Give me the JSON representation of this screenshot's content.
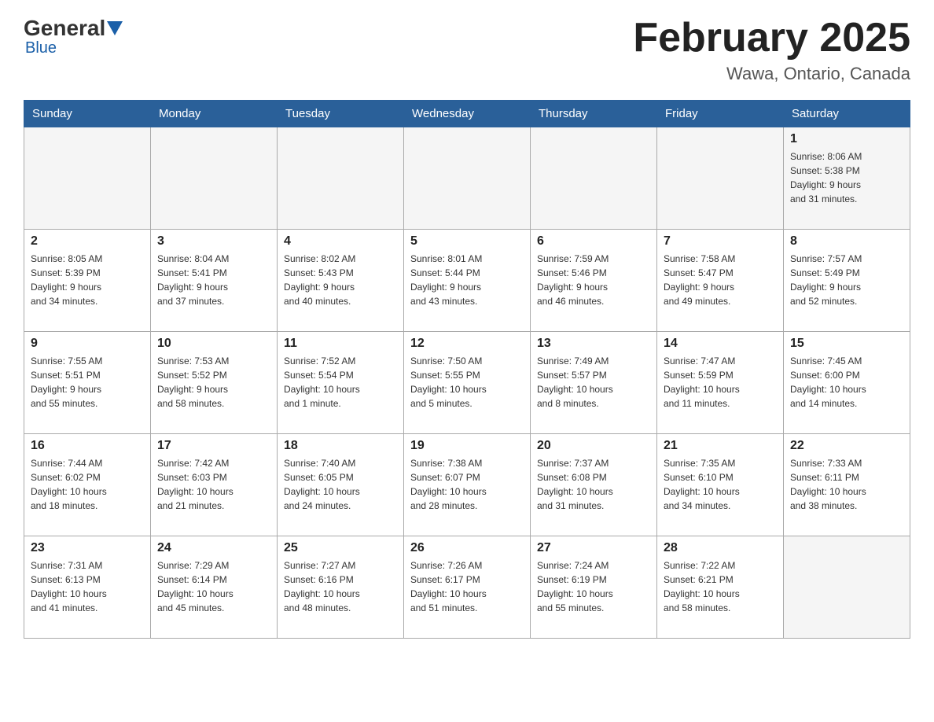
{
  "header": {
    "logo_general": "General",
    "logo_blue": "Blue",
    "month_title": "February 2025",
    "location": "Wawa, Ontario, Canada"
  },
  "weekdays": [
    "Sunday",
    "Monday",
    "Tuesday",
    "Wednesday",
    "Thursday",
    "Friday",
    "Saturday"
  ],
  "weeks": [
    [
      {
        "day": "",
        "info": ""
      },
      {
        "day": "",
        "info": ""
      },
      {
        "day": "",
        "info": ""
      },
      {
        "day": "",
        "info": ""
      },
      {
        "day": "",
        "info": ""
      },
      {
        "day": "",
        "info": ""
      },
      {
        "day": "1",
        "info": "Sunrise: 8:06 AM\nSunset: 5:38 PM\nDaylight: 9 hours\nand 31 minutes."
      }
    ],
    [
      {
        "day": "2",
        "info": "Sunrise: 8:05 AM\nSunset: 5:39 PM\nDaylight: 9 hours\nand 34 minutes."
      },
      {
        "day": "3",
        "info": "Sunrise: 8:04 AM\nSunset: 5:41 PM\nDaylight: 9 hours\nand 37 minutes."
      },
      {
        "day": "4",
        "info": "Sunrise: 8:02 AM\nSunset: 5:43 PM\nDaylight: 9 hours\nand 40 minutes."
      },
      {
        "day": "5",
        "info": "Sunrise: 8:01 AM\nSunset: 5:44 PM\nDaylight: 9 hours\nand 43 minutes."
      },
      {
        "day": "6",
        "info": "Sunrise: 7:59 AM\nSunset: 5:46 PM\nDaylight: 9 hours\nand 46 minutes."
      },
      {
        "day": "7",
        "info": "Sunrise: 7:58 AM\nSunset: 5:47 PM\nDaylight: 9 hours\nand 49 minutes."
      },
      {
        "day": "8",
        "info": "Sunrise: 7:57 AM\nSunset: 5:49 PM\nDaylight: 9 hours\nand 52 minutes."
      }
    ],
    [
      {
        "day": "9",
        "info": "Sunrise: 7:55 AM\nSunset: 5:51 PM\nDaylight: 9 hours\nand 55 minutes."
      },
      {
        "day": "10",
        "info": "Sunrise: 7:53 AM\nSunset: 5:52 PM\nDaylight: 9 hours\nand 58 minutes."
      },
      {
        "day": "11",
        "info": "Sunrise: 7:52 AM\nSunset: 5:54 PM\nDaylight: 10 hours\nand 1 minute."
      },
      {
        "day": "12",
        "info": "Sunrise: 7:50 AM\nSunset: 5:55 PM\nDaylight: 10 hours\nand 5 minutes."
      },
      {
        "day": "13",
        "info": "Sunrise: 7:49 AM\nSunset: 5:57 PM\nDaylight: 10 hours\nand 8 minutes."
      },
      {
        "day": "14",
        "info": "Sunrise: 7:47 AM\nSunset: 5:59 PM\nDaylight: 10 hours\nand 11 minutes."
      },
      {
        "day": "15",
        "info": "Sunrise: 7:45 AM\nSunset: 6:00 PM\nDaylight: 10 hours\nand 14 minutes."
      }
    ],
    [
      {
        "day": "16",
        "info": "Sunrise: 7:44 AM\nSunset: 6:02 PM\nDaylight: 10 hours\nand 18 minutes."
      },
      {
        "day": "17",
        "info": "Sunrise: 7:42 AM\nSunset: 6:03 PM\nDaylight: 10 hours\nand 21 minutes."
      },
      {
        "day": "18",
        "info": "Sunrise: 7:40 AM\nSunset: 6:05 PM\nDaylight: 10 hours\nand 24 minutes."
      },
      {
        "day": "19",
        "info": "Sunrise: 7:38 AM\nSunset: 6:07 PM\nDaylight: 10 hours\nand 28 minutes."
      },
      {
        "day": "20",
        "info": "Sunrise: 7:37 AM\nSunset: 6:08 PM\nDaylight: 10 hours\nand 31 minutes."
      },
      {
        "day": "21",
        "info": "Sunrise: 7:35 AM\nSunset: 6:10 PM\nDaylight: 10 hours\nand 34 minutes."
      },
      {
        "day": "22",
        "info": "Sunrise: 7:33 AM\nSunset: 6:11 PM\nDaylight: 10 hours\nand 38 minutes."
      }
    ],
    [
      {
        "day": "23",
        "info": "Sunrise: 7:31 AM\nSunset: 6:13 PM\nDaylight: 10 hours\nand 41 minutes."
      },
      {
        "day": "24",
        "info": "Sunrise: 7:29 AM\nSunset: 6:14 PM\nDaylight: 10 hours\nand 45 minutes."
      },
      {
        "day": "25",
        "info": "Sunrise: 7:27 AM\nSunset: 6:16 PM\nDaylight: 10 hours\nand 48 minutes."
      },
      {
        "day": "26",
        "info": "Sunrise: 7:26 AM\nSunset: 6:17 PM\nDaylight: 10 hours\nand 51 minutes."
      },
      {
        "day": "27",
        "info": "Sunrise: 7:24 AM\nSunset: 6:19 PM\nDaylight: 10 hours\nand 55 minutes."
      },
      {
        "day": "28",
        "info": "Sunrise: 7:22 AM\nSunset: 6:21 PM\nDaylight: 10 hours\nand 58 minutes."
      },
      {
        "day": "",
        "info": ""
      }
    ]
  ]
}
